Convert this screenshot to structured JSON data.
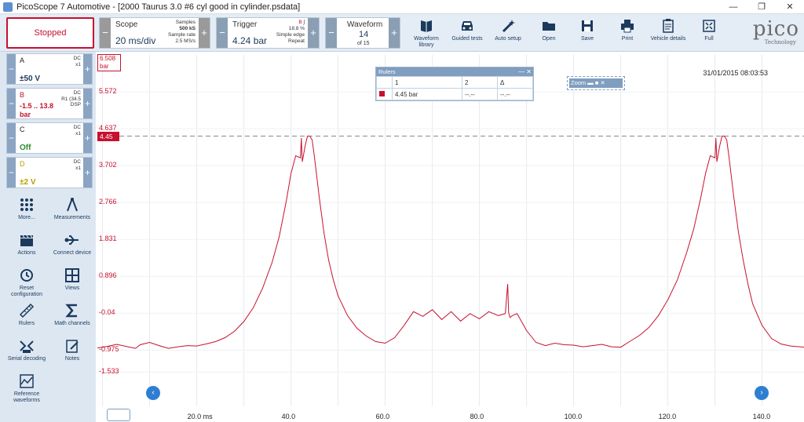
{
  "window": {
    "title": "PicoScope 7 Automotive - [2000 Taurus 3.0 #6 cyl good in cylinder.psdata]",
    "min_glyph": "—",
    "max_glyph": "❐",
    "close_glyph": "✕"
  },
  "toolbar": {
    "run_state": "Stopped",
    "scope": {
      "label": "Scope",
      "timebase": "20 ms/div",
      "samples_label": "Samples",
      "samples_value": "500 kS",
      "rate_label": "Sample rate",
      "rate_value": "2.5 MS/s"
    },
    "trigger": {
      "label": "Trigger",
      "level": "4.24 bar",
      "channel": "B",
      "percent": "18.8 %",
      "edge": "Simple edge",
      "mode": "Repeat"
    },
    "waveform": {
      "label": "Waveform",
      "current": "14",
      "total": "of 15"
    },
    "buttons": [
      {
        "label": "Waveform library",
        "icon": "book-icon"
      },
      {
        "label": "Guided tests",
        "icon": "car-icon"
      },
      {
        "label": "Auto setup",
        "icon": "wand-icon"
      },
      {
        "label": "Open",
        "icon": "folder-icon"
      },
      {
        "label": "Save",
        "icon": "save-icon"
      },
      {
        "label": "Print",
        "icon": "printer-icon"
      },
      {
        "label": "Vehicle details",
        "icon": "clipboard-icon"
      },
      {
        "label": "Full",
        "icon": "fullscreen-icon"
      }
    ],
    "logo": {
      "word": "pico",
      "sub": "Technology"
    }
  },
  "channels": [
    {
      "name": "A",
      "value": "±50 V",
      "coupling": "DC",
      "probe": "x1",
      "extra": "",
      "color": "#1b3a5c"
    },
    {
      "name": "B",
      "value": "-1.5 .. 13.8 bar",
      "coupling": "DC",
      "probe": "R1 (34.5",
      "extra": "DSP",
      "color": "#c8102e"
    },
    {
      "name": "C",
      "value": "Off",
      "coupling": "DC",
      "probe": "x1",
      "extra": "",
      "color": "#2e8b2e"
    },
    {
      "name": "D",
      "value": "±2 V",
      "coupling": "DC",
      "probe": "x1",
      "extra": "",
      "color": "#b8a000"
    }
  ],
  "tools": [
    {
      "label": "More...",
      "icon": "grid-dots-icon"
    },
    {
      "label": "Measurements",
      "icon": "compass-icon"
    },
    {
      "label": "Actions",
      "icon": "clapper-icon"
    },
    {
      "label": "Connect device",
      "icon": "usb-icon"
    },
    {
      "label": "Reset configuration",
      "icon": "history-icon"
    },
    {
      "label": "Views",
      "icon": "views-icon"
    },
    {
      "label": "Rulers",
      "icon": "ruler-icon"
    },
    {
      "label": "Math channels",
      "icon": "sigma-icon"
    },
    {
      "label": "Serial decoding",
      "icon": "serial-icon"
    },
    {
      "label": "Notes",
      "icon": "notes-icon"
    },
    {
      "label": "Reference waveforms",
      "icon": "reference-icon"
    }
  ],
  "scope_view": {
    "timestamp": "31/01/2015 08:03:53",
    "top_flag_value": "6.508",
    "top_flag_unit": "bar",
    "trigger_flag": "4.45",
    "trigger_color": "#c8102e",
    "rulers": {
      "title": "Rulers",
      "col1": "1",
      "col2": "2",
      "col3": "Δ",
      "row_value": "4.45 bar",
      "row_v2": "--.--",
      "row_delta": "--.--"
    },
    "zoom_label": "Zoom",
    "nav_left": "‹",
    "nav_right": "›"
  },
  "chart_data": {
    "type": "line",
    "xlabel": "",
    "ylabel": "",
    "x_unit": "ms",
    "xlim": [
      -1.1,
      148.9
    ],
    "ylim": [
      -2.4,
      6.508
    ],
    "x_ticks": [
      "20.0 ms",
      "40.0",
      "60.0",
      "80.0",
      "100.0",
      "120.0",
      "140.0"
    ],
    "y_ticks": [
      "5.572",
      "4.637",
      "3.702",
      "2.766",
      "1.831",
      "0.896",
      "-0.04",
      "-0.975",
      "-1.533"
    ],
    "reference_line": 4.45,
    "series": [
      {
        "color": "#c8102e",
        "x": [
          -1.1,
          1,
          3,
          5,
          7,
          8,
          10,
          12,
          14,
          16,
          18,
          20,
          22,
          24,
          26,
          28,
          30,
          32,
          34,
          36,
          37.5,
          39,
          40,
          41,
          42,
          42.2,
          42.4,
          43,
          43.5,
          44,
          44.5,
          45,
          46,
          47,
          48,
          49,
          50,
          52,
          54,
          56,
          58,
          60,
          62,
          64,
          66,
          68,
          70,
          72,
          74,
          76,
          78,
          80,
          82,
          84,
          85.5,
          86,
          86.2,
          86.5,
          87,
          88,
          90,
          92,
          94,
          96,
          98,
          100,
          102,
          104,
          106,
          108,
          110,
          112,
          114,
          116,
          118,
          120,
          122,
          124,
          125.5,
          127,
          128,
          129,
          130,
          130.2,
          130.4,
          131,
          131.5,
          132,
          132.5,
          133,
          134,
          135,
          136,
          137,
          138,
          140,
          142,
          144,
          146,
          148.9
        ],
        "y": [
          -0.92,
          -0.88,
          -0.83,
          -0.88,
          -0.93,
          -0.84,
          -0.78,
          -0.86,
          -0.93,
          -0.89,
          -0.86,
          -0.87,
          -0.82,
          -0.76,
          -0.66,
          -0.5,
          -0.25,
          0.1,
          0.6,
          1.25,
          1.9,
          2.8,
          3.5,
          3.95,
          3.9,
          4.4,
          3.8,
          4.2,
          4.45,
          4.45,
          4.35,
          3.9,
          2.9,
          2.0,
          1.3,
          0.8,
          0.4,
          -0.1,
          -0.42,
          -0.62,
          -0.76,
          -0.8,
          -0.66,
          -0.35,
          0.0,
          -0.12,
          0.05,
          -0.2,
          0.0,
          -0.24,
          -0.05,
          -0.18,
          0.0,
          -0.1,
          -0.05,
          0.7,
          -0.03,
          -0.15,
          -0.1,
          -0.05,
          -0.48,
          -0.78,
          -0.86,
          -0.8,
          -0.84,
          -0.85,
          -0.89,
          -0.86,
          -0.83,
          -0.89,
          -0.9,
          -0.75,
          -0.6,
          -0.4,
          -0.1,
          0.3,
          0.8,
          1.5,
          2.1,
          2.9,
          3.5,
          3.95,
          3.9,
          4.4,
          3.8,
          4.2,
          4.45,
          4.45,
          4.35,
          3.9,
          2.9,
          2.0,
          1.3,
          0.7,
          0.2,
          -0.35,
          -0.68,
          -0.82,
          -0.87,
          -0.9
        ]
      }
    ]
  }
}
